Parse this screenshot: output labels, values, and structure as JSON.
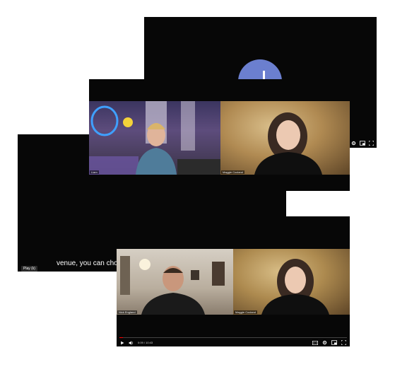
{
  "frames": {
    "back_top": {
      "controls": [
        "settings-icon",
        "miniplayer-icon",
        "fullscreen-icon"
      ]
    },
    "mid": {
      "participants": [
        {
          "name": "Liam"
        },
        {
          "name": "Maggie Cocland"
        }
      ]
    },
    "left": {
      "caption": "venue, you can choo",
      "play_chip": "Play (k)"
    },
    "front": {
      "participants": [
        {
          "name": "Nick England"
        },
        {
          "name": "Maggie Cocland"
        }
      ],
      "time": "0:09 / 10:43",
      "progress_fraction": 0.015,
      "progress_color": "#ff0000",
      "controls": [
        "play-icon",
        "volume-icon",
        "cc-icon",
        "settings-icon",
        "miniplayer-icon",
        "fullscreen-icon"
      ]
    }
  },
  "colors": {
    "frame_bg": "#070707",
    "avatar": "#6b7fcf",
    "page_bg": "#ffffff"
  }
}
